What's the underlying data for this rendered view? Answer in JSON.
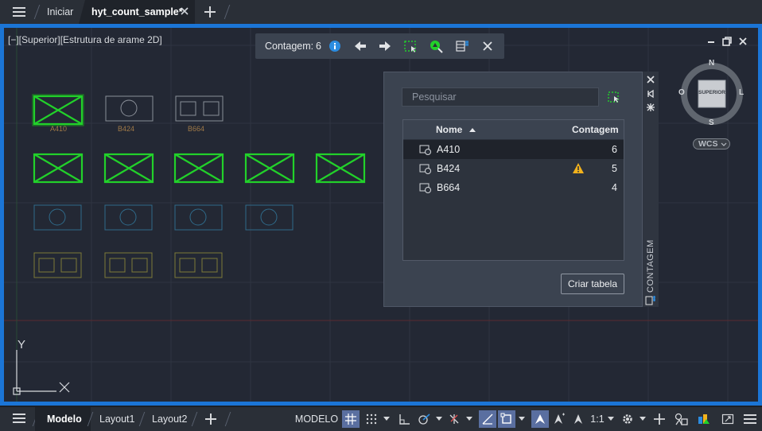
{
  "top_tabs": {
    "home_label": "Iniciar",
    "file_label": "hyt_count_sample*"
  },
  "viewport": {
    "label": "[−][Superior][Estrutura de arame 2D]",
    "border_color": "#1b75d6",
    "accent_green": "#22d12a"
  },
  "count_toolbar": {
    "label": "Contagem:",
    "value": "6"
  },
  "palette": {
    "search_placeholder": "Pesquisar",
    "columns": {
      "name": "Nome",
      "count": "Contagem"
    },
    "rows": [
      {
        "name": "A410",
        "count": "6",
        "warning": false,
        "selected": true
      },
      {
        "name": "B424",
        "count": "5",
        "warning": true,
        "selected": false
      },
      {
        "name": "B664",
        "count": "4",
        "warning": false,
        "selected": false
      }
    ],
    "create_table_label": "Criar tabela",
    "side_title": "CONTAGEM"
  },
  "drawing": {
    "labels": [
      "A410",
      "B424",
      "B664"
    ]
  },
  "viewcube": {
    "north": "N",
    "south": "S",
    "west": "O",
    "east": "L",
    "face": "SUPERIOR",
    "ucs_label": "WCS"
  },
  "ucs": {
    "y_label": "Y"
  },
  "status_bar": {
    "tabs": [
      "Modelo",
      "Layout1",
      "Layout2"
    ],
    "space_label": "MODELO",
    "scale_label": "1:1"
  }
}
